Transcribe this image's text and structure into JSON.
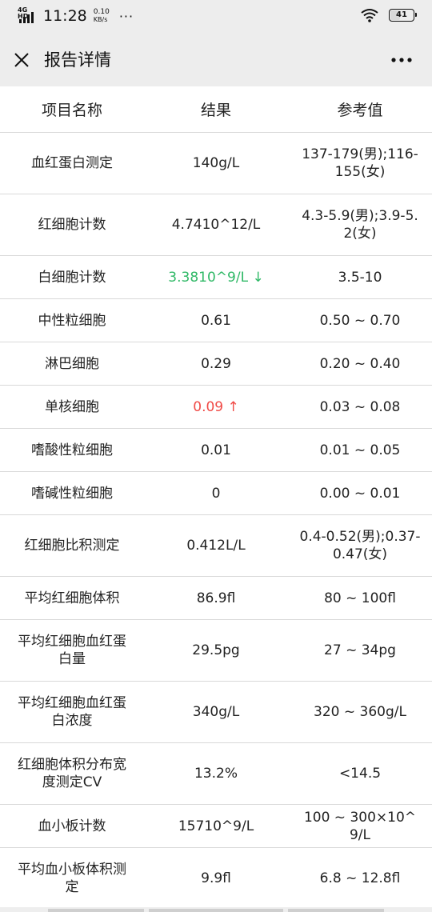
{
  "status_bar": {
    "network": "4G HD",
    "time": "11:28",
    "speed_value": "0.10",
    "speed_unit": "KB/s",
    "more_dots": "···",
    "battery_level": "41"
  },
  "header": {
    "title": "报告详情",
    "close_icon": "close-icon",
    "more_icon": "more-icon"
  },
  "table": {
    "columns": [
      "项目名称",
      "结果",
      "参考值"
    ],
    "rows": [
      {
        "name": "血红蛋白测定",
        "result": "140g/L",
        "reference": "137-179(男);116-155(女)",
        "status": "normal"
      },
      {
        "name": "红细胞计数",
        "result": "4.7410^12/L",
        "reference": "4.3-5.9(男);3.9-5.2(女)",
        "status": "normal"
      },
      {
        "name": "白细胞计数",
        "result": "3.3810^9/L ↓",
        "reference": "3.5-10",
        "status": "low"
      },
      {
        "name": "中性粒细胞",
        "result": "0.61",
        "reference": "0.50 ~ 0.70",
        "status": "normal"
      },
      {
        "name": "淋巴细胞",
        "result": "0.29",
        "reference": "0.20 ~ 0.40",
        "status": "normal"
      },
      {
        "name": "单核细胞",
        "result": "0.09 ↑",
        "reference": "0.03 ~ 0.08",
        "status": "high"
      },
      {
        "name": "嗜酸性粒细胞",
        "result": "0.01",
        "reference": "0.01 ~ 0.05",
        "status": "normal"
      },
      {
        "name": "嗜碱性粒细胞",
        "result": "0",
        "reference": "0.00 ~ 0.01",
        "status": "normal"
      },
      {
        "name": "红细胞比积测定",
        "result": "0.412L/L",
        "reference": "0.4-0.52(男);0.37-0.47(女)",
        "status": "normal"
      },
      {
        "name": "平均红细胞体积",
        "result": "86.9fl",
        "reference": "80 ~ 100fl",
        "status": "normal"
      },
      {
        "name": "平均红细胞血红蛋白量",
        "result": "29.5pg",
        "reference": "27 ~ 34pg",
        "status": "normal"
      },
      {
        "name": "平均红细胞血红蛋白浓度",
        "result": "340g/L",
        "reference": "320 ~ 360g/L",
        "status": "normal"
      },
      {
        "name": "红细胞体积分布宽度测定CV",
        "result": "13.2%",
        "reference": "<14.5",
        "status": "normal"
      },
      {
        "name": "血小板计数",
        "result": "15710^9/L",
        "reference": "100 ~ 300×10^9/L",
        "status": "normal"
      },
      {
        "name": "平均血小板体积测定",
        "result": "9.9fl",
        "reference": "6.8 ~ 12.8fl",
        "status": "normal"
      }
    ]
  },
  "colors": {
    "low": "#2fb866",
    "high": "#f04b47",
    "header_bg": "#ededed",
    "divider": "#d9d9d9"
  }
}
